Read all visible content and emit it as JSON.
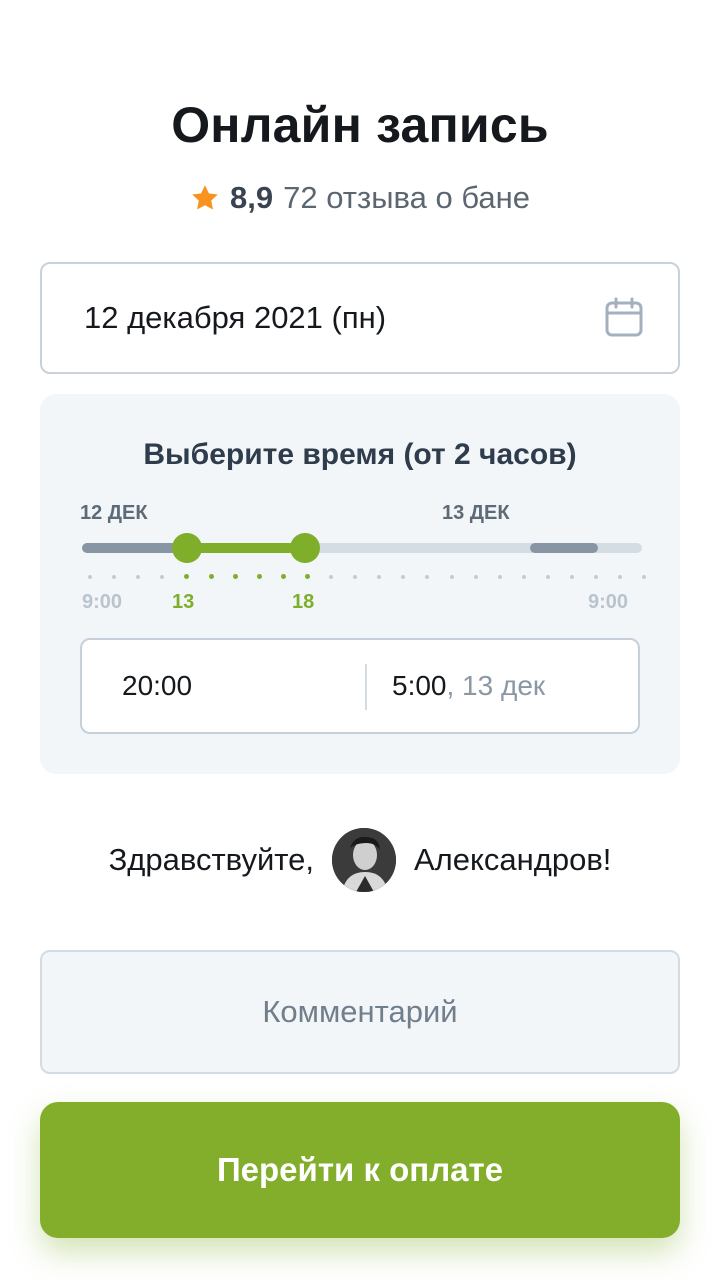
{
  "header": {
    "title": "Онлайн запись",
    "rating": {
      "icon": "star-icon",
      "star_color": "#f7931e",
      "score": "8,9",
      "reviews": "72 отзыва о бане"
    }
  },
  "date_field": {
    "value": "12 декабря 2021 (пн)",
    "icon": "calendar-icon"
  },
  "time_picker": {
    "title": "Выберите время (от 2 часов)",
    "day_labels": [
      "12 ДЕК",
      "13 ДЕК"
    ],
    "ticks": [
      "9:00",
      "13",
      "18",
      "9:00"
    ],
    "selected_start_hour": 13,
    "selected_end_hour": 18,
    "range_from": "20:00",
    "range_to_time": "5:00",
    "range_to_date": ", 13 дек",
    "accent_color": "#7fae2a"
  },
  "greeting": {
    "hello": "Здравствуйте,",
    "name": "Александров!",
    "avatar": "user-avatar"
  },
  "comment": {
    "placeholder": "Комментарий",
    "value": ""
  },
  "actions": {
    "pay_label": "Перейти к оплате",
    "pay_color": "#82ae2b"
  }
}
